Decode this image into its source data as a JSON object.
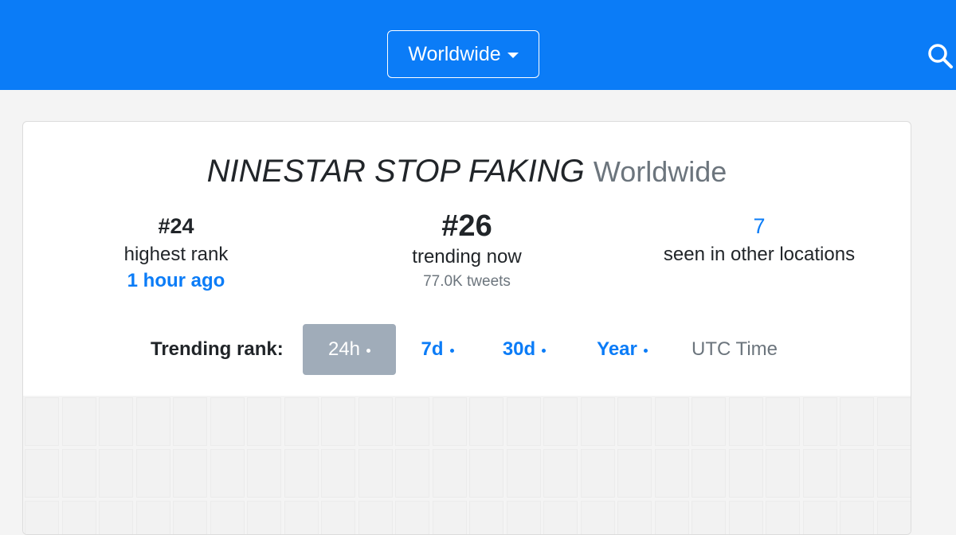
{
  "nav": {
    "location_label": "Worldwide",
    "brand_color": "#0b7cf7",
    "search_icon": "search-icon"
  },
  "trend": {
    "name": "NINESTAR STOP FAKING",
    "location": "Worldwide"
  },
  "stats": {
    "highest_rank_value": "#24",
    "highest_rank_label": "highest rank",
    "highest_rank_time": "1 hour ago",
    "now_value": "#26",
    "now_label": "trending now",
    "now_tweets": "77.0K tweets",
    "other_value": "7",
    "other_label": "seen in other locations"
  },
  "range": {
    "label": "Trending rank:",
    "options": [
      {
        "label": "24h",
        "active": true
      },
      {
        "label": "7d",
        "active": false
      },
      {
        "label": "30d",
        "active": false
      },
      {
        "label": "Year",
        "active": false
      }
    ],
    "timezone": "UTC Time"
  }
}
